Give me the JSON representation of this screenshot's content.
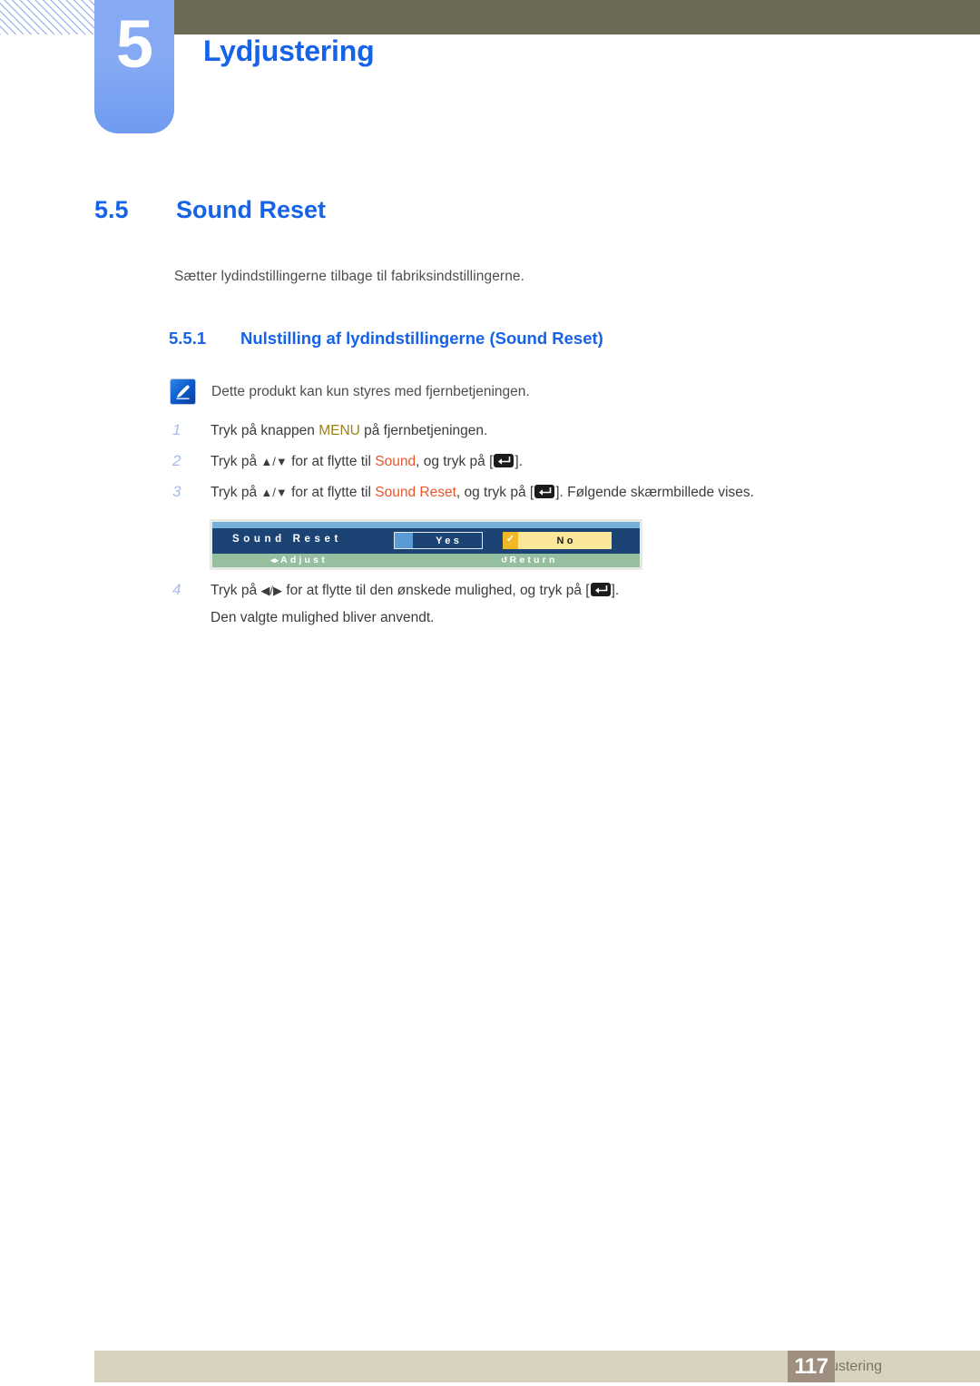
{
  "header": {
    "chapter_number": "5",
    "chapter_title": "Lydjustering"
  },
  "section": {
    "number": "5.5",
    "title": "Sound Reset",
    "intro": "Sætter lydindstillingerne tilbage til fabriksindstillingerne."
  },
  "subsection": {
    "number": "5.5.1",
    "title": "Nulstilling af lydindstillingerne (Sound Reset)"
  },
  "note": {
    "icon": "note-pencil-icon",
    "text": "Dette produkt kan kun styres med fjernbetjeningen."
  },
  "steps": [
    {
      "number": "1",
      "prefix": "Tryk på knappen ",
      "keyword": "MENU",
      "keyword_color": "#9a8118",
      "suffix": " på fjernbetjeningen."
    },
    {
      "number": "2",
      "prefix": "Tryk på ",
      "arrows": "▲/▼",
      "mid": " for at flytte til ",
      "keyword": "Sound",
      "keyword_color": "#e8552a",
      "after_keyword": ", og tryk på [",
      "key_icon": "enter-key-icon",
      "suffix": "]."
    },
    {
      "number": "3",
      "prefix": "Tryk på ",
      "arrows": "▲/▼",
      "mid": " for at flytte til ",
      "keyword": "Sound Reset",
      "keyword_color": "#e8552a",
      "after_keyword": ", og tryk på [",
      "key_icon": "enter-key-icon",
      "suffix": "]. Følgende skærmbillede vises."
    },
    {
      "number": "4",
      "prefix": "Tryk på ",
      "arrows": "◀/▶",
      "mid": " for at flytte til den ønskede mulighed, og tryk på [",
      "key_icon": "enter-key-icon",
      "suffix": "].",
      "continuation": "Den valgte mulighed bliver anvendt."
    }
  ],
  "osd": {
    "title": "Sound Reset",
    "options": [
      {
        "label": "Yes",
        "selected": false
      },
      {
        "label": "No",
        "selected": true,
        "check": "✓"
      }
    ],
    "footer": [
      {
        "glyph": "◂▸",
        "label": "Adjust"
      },
      {
        "glyph": "↺",
        "label": "Return"
      }
    ],
    "colors": {
      "body": "#1b4474",
      "top_strip": "#74b0d8",
      "foot_bar": "#96bfa0",
      "highlight": "#fbe79a",
      "swatch": "#5b9bd5"
    }
  },
  "footer": {
    "text": "5 Lydjustering",
    "page": "117"
  },
  "theme": {
    "accent_blue": "#1663e8",
    "tab_blue": "#85aaf3",
    "olive": "#6d6b57",
    "footer_beige": "#d8d3bf",
    "page_box": "#9e8f80"
  }
}
